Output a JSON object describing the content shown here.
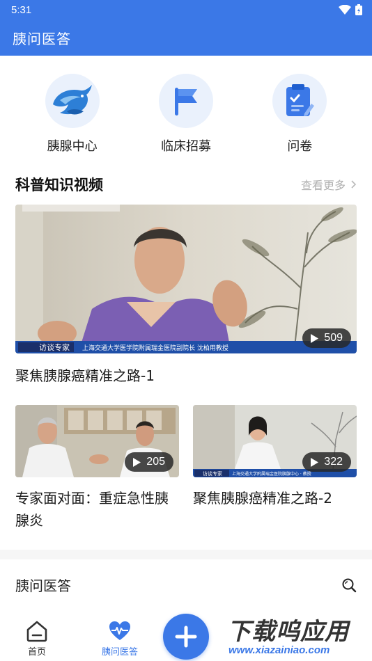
{
  "status": {
    "time": "5:31"
  },
  "app": {
    "title": "胰问医答"
  },
  "quick_links": [
    {
      "label": "胰腺中心",
      "icon": "dolphin-logo-icon"
    },
    {
      "label": "临床招募",
      "icon": "flag-icon"
    },
    {
      "label": "问卷",
      "icon": "clipboard-icon"
    }
  ],
  "videos_section": {
    "title": "科普知识视频",
    "see_more": "查看更多"
  },
  "videos": [
    {
      "title": "聚焦胰腺癌精准之路-1",
      "views": "509",
      "caption_left": "访谈专家",
      "caption_right": "上海交通大学医学院附属瑞金医院副院长  沈柏用教授"
    },
    {
      "title": "专家面对面：重症急性胰腺炎",
      "views": "205"
    },
    {
      "title": "聚焦胰腺癌精准之路-2",
      "views": "322",
      "caption_left": "访谈专家",
      "caption_right": "上海交通大学附属瑞金医院胰腺中心 · 教授"
    }
  ],
  "bottom_section": {
    "title": "胰问医答"
  },
  "tabs": [
    {
      "label": "首页",
      "icon": "home-icon"
    },
    {
      "label": "胰问医答",
      "icon": "heart-pulse-icon"
    }
  ],
  "watermark": {
    "main": "下载呜应用",
    "sub": "www.xiazainiao.com"
  },
  "colors": {
    "primary": "#3b78e7",
    "icon_bg": "#eaf1fc"
  }
}
